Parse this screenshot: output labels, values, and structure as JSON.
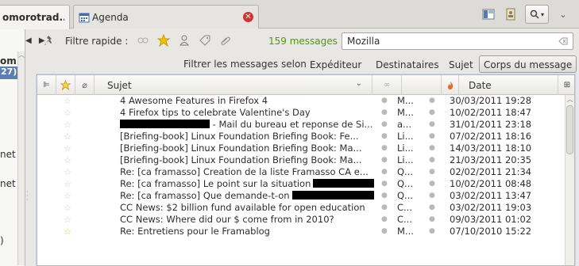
{
  "tabs": [
    {
      "label": "omorotrad...",
      "active": true
    },
    {
      "label": "Agenda",
      "active": false
    }
  ],
  "icons": {
    "close": "close-icon",
    "search": "search-icon",
    "layout": "layout-icon",
    "addressbook": "address-book-icon"
  },
  "quickfilter": {
    "label": "Filtre rapide :",
    "count": "159 messages",
    "search_value": "Mozilla"
  },
  "filterby": {
    "label": "Filtrer les messages selon :",
    "options": [
      "Expéditeur",
      "Destinataires",
      "Sujet",
      "Corps du message"
    ],
    "active_index": 3
  },
  "folderpane": {
    "items": [
      "om",
      "27)",
      "net",
      "net",
      ")"
    ]
  },
  "columns": {
    "subject": "Sujet",
    "date": "Date"
  },
  "messages": [
    {
      "subject": "4 Awesome Features in Firefox 4",
      "from": "M...",
      "date": "30/03/2011 19:28",
      "starred": false
    },
    {
      "subject": "4 Firefox tips to celebrate Valentine's Day",
      "from": "M...",
      "date": "10/02/2011 18:47",
      "starred": false
    },
    {
      "subject": " - Mail du bureau et reponse de Si...",
      "from": "a...",
      "date": "31/01/2011 23:18",
      "starred": false
    },
    {
      "subject": "[Briefing-book] Linux Foundation Briefing Book: Fe...",
      "from": "Li...",
      "date": "07/02/2011 18:16",
      "starred": false
    },
    {
      "subject": "[Briefing-book] Linux Foundation Briefing Book: Ma...",
      "from": "Li...",
      "date": "14/03/2011 18:10",
      "starred": false
    },
    {
      "subject": "[Briefing-book] Linux Foundation Briefing Book: Ma...",
      "from": "Li...",
      "date": "21/03/2011 20:35",
      "starred": false
    },
    {
      "subject": "Re: [ca framasso] Creation de la liste Framasso CA e...",
      "from": "Q...",
      "date": "02/02/2011 21:34",
      "starred": false
    },
    {
      "subject": "Re: [ca framasso] Le point sur la situation",
      "from": "Q...",
      "date": "10/02/2011 08:48",
      "starred": false
    },
    {
      "subject": "Re: [ca framasso] Que demande-t-on",
      "from": "Q...",
      "date": "03/02/2011 13:47",
      "starred": false
    },
    {
      "subject": "CC News: $2 billion fund available for open education",
      "from": "C...",
      "date": "03/02/2011 19:03",
      "starred": false
    },
    {
      "subject": "CC News: Where did our $ come from in 2010?",
      "from": "C...",
      "date": "09/03/2011 01:02",
      "starred": false
    },
    {
      "subject": "Re: Entretiens pour le Framablog",
      "from": "M...",
      "date": "07/10/2010 15:22",
      "starred": true
    }
  ]
}
